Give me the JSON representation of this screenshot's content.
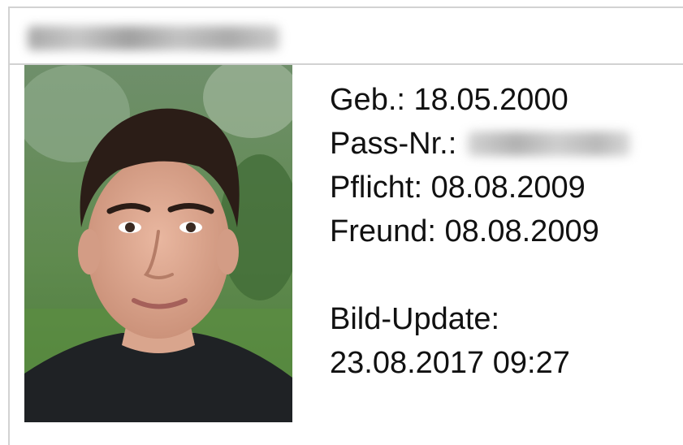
{
  "header": {
    "name_redacted": true
  },
  "photo": {
    "alt": "profile-photo"
  },
  "info": {
    "birth_label": "Geb.:",
    "birth_value": "18.05.2000",
    "pass_label": "Pass-Nr.:",
    "pass_value_redacted": true,
    "pflicht_label": "Pflicht:",
    "pflicht_value": "08.08.2009",
    "freund_label": "Freund:",
    "freund_value": "08.08.2009",
    "update_label": "Bild-Update:",
    "update_value": "23.08.2017 09:27"
  }
}
